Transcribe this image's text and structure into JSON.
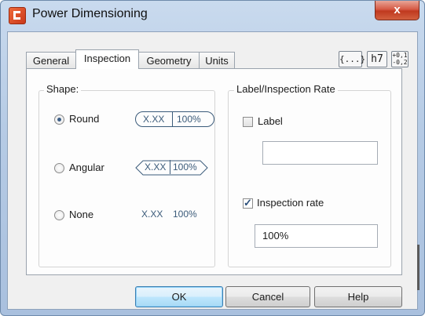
{
  "window": {
    "title": "Power Dimensioning",
    "close_glyph": "x"
  },
  "tabs": [
    {
      "label": "General"
    },
    {
      "label": "Inspection"
    },
    {
      "label": "Geometry"
    },
    {
      "label": "Units"
    }
  ],
  "active_tab": "Inspection",
  "toolbar_icons": [
    {
      "name": "brackets-icon",
      "glyph": "{...}"
    },
    {
      "name": "fit-h7-icon",
      "glyph": "h7"
    },
    {
      "name": "tolerance-icon",
      "glyph_top": "+0,1",
      "glyph_bottom": "-0,2"
    }
  ],
  "shape": {
    "group_label": "Shape:",
    "options": [
      {
        "label": "Round",
        "value": "X.XX",
        "rate": "100%",
        "checked": true
      },
      {
        "label": "Angular",
        "value": "X.XX",
        "rate": "100%",
        "checked": false
      },
      {
        "label": "None",
        "value": "X.XX",
        "rate": "100%",
        "checked": false
      }
    ]
  },
  "label_rate": {
    "group_label": "Label/Inspection Rate",
    "label_checkbox": {
      "label": "Label",
      "checked": false
    },
    "label_value": "",
    "rate_checkbox": {
      "label": "Inspection rate",
      "checked": true
    },
    "rate_value": "100%"
  },
  "buttons": {
    "ok": "OK",
    "cancel": "Cancel",
    "help": "Help"
  },
  "colors": {
    "accent": "#3b5b7a",
    "close": "#c0391f",
    "frame": "#b6cbe5"
  }
}
